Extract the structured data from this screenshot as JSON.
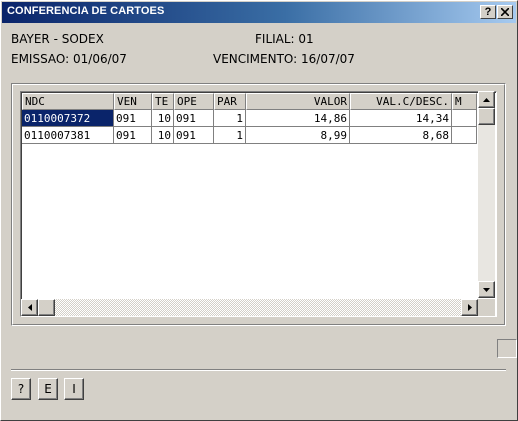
{
  "window": {
    "title": "CONFERENCIA DE CARTOES",
    "help_button": "?",
    "close_button": "x"
  },
  "info": {
    "client": "BAYER - SODEX",
    "filial": "FILIAL: 01",
    "emissao": "EMISSAO: 01/06/07",
    "vencimento": "VENCIMENTO: 16/07/07"
  },
  "grid": {
    "columns": [
      "NDC",
      "VEN",
      "TE",
      "OPE",
      "PAR",
      "VALOR",
      "VAL.C/DESC.",
      "M"
    ],
    "rows": [
      [
        "0110007372",
        "091",
        "10",
        "091",
        "1",
        "14,86",
        "14,34",
        ""
      ],
      [
        "0110007381",
        "091",
        "10",
        "091",
        "1",
        "8,99",
        "8,68",
        ""
      ]
    ],
    "selected_row": 0
  },
  "buttons": {
    "help": "?",
    "e": "E",
    "i": "I"
  },
  "colors": {
    "title_start": "#0a246a",
    "title_end": "#a6caf0",
    "selection": "#0a246a",
    "face": "#d4d0c8"
  }
}
